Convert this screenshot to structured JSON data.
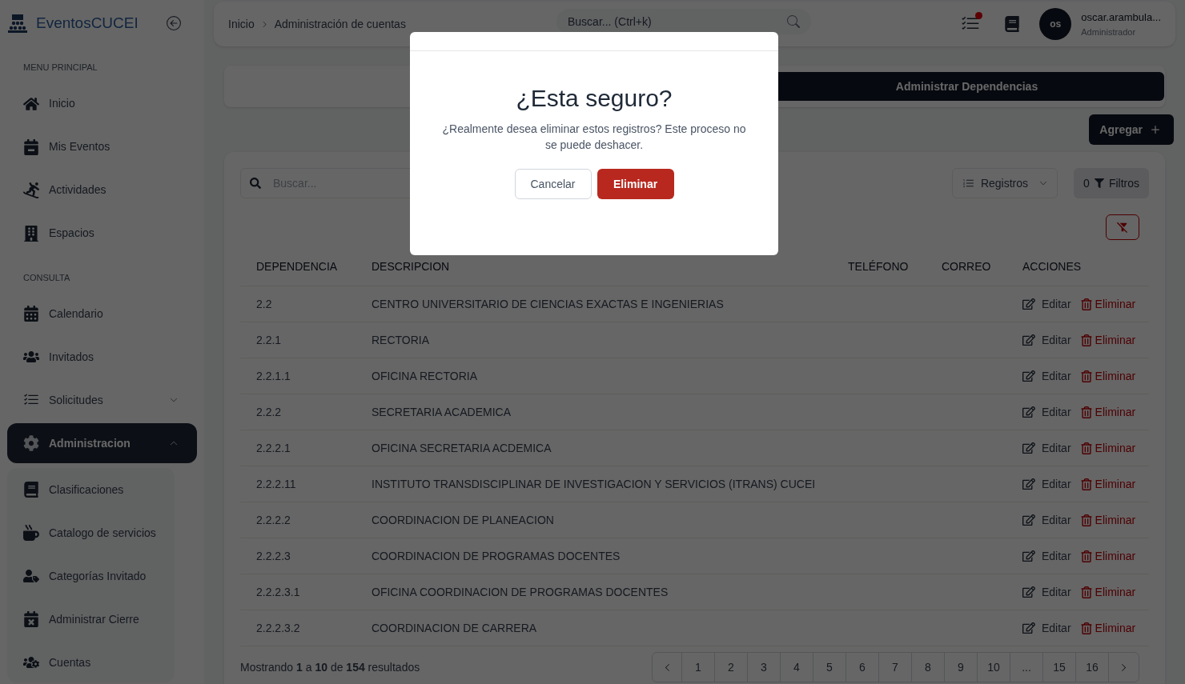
{
  "sidebar": {
    "logo_text": "EventosCUCEI",
    "sections": [
      {
        "title": "MENU PRINCIPAL",
        "items": [
          {
            "label": "Inicio",
            "selected": false
          },
          {
            "label": "Mis Eventos",
            "selected": false
          },
          {
            "label": "Actividades",
            "selected": false
          },
          {
            "label": "Espacios",
            "selected": false
          }
        ]
      },
      {
        "title": "CONSULTA",
        "items": [
          {
            "label": "Calendario",
            "selected": false
          },
          {
            "label": "Invitados",
            "selected": false
          },
          {
            "label": "Solicitudes",
            "selected": false,
            "expanded": false
          },
          {
            "label": "Administracion",
            "selected": true,
            "expanded": true,
            "children": [
              {
                "label": "Clasificaciones",
                "selected": false
              },
              {
                "label": "Catalogo de servicios",
                "selected": false
              },
              {
                "label": "Categorías Invitado",
                "selected": false
              },
              {
                "label": "Administrar Cierre",
                "selected": false
              },
              {
                "label": "Cuentas",
                "selected": false
              }
            ]
          }
        ]
      }
    ]
  },
  "header": {
    "breadcrumb": [
      "Inicio",
      "Administración de cuentas"
    ],
    "search": {
      "placeholder": "Buscar... (Ctrl+k)"
    },
    "notification": true,
    "user": {
      "initials": "os",
      "name": "oscar.arambula...",
      "role": "Administrador"
    }
  },
  "tab": {
    "label": "Administrar Dependencias",
    "selected": true
  },
  "add_button": "Agregar",
  "toolbar": {
    "search": {
      "placeholder": "Buscar..."
    },
    "records_button": "Registros",
    "filters_count": "0",
    "filters_button": "Filtros"
  },
  "table": {
    "columns": [
      "DEPENDENCIA",
      "DESCRIPCION",
      "TELÉFONO",
      "CORREO",
      "ACCIONES"
    ],
    "rows": [
      {
        "dependencia": "2.2",
        "descripcion": "CENTRO UNIVERSITARIO DE CIENCIAS EXACTAS E INGENIERIAS",
        "edit": "Editar",
        "delete": "Eliminar"
      },
      {
        "dependencia": "2.2.1",
        "descripcion": "RECTORIA",
        "edit": "Editar",
        "delete": "Eliminar"
      },
      {
        "dependencia": "2.2.1.1",
        "descripcion": "OFICINA RECTORIA",
        "edit": "Editar",
        "delete": "Eliminar"
      },
      {
        "dependencia": "2.2.2",
        "descripcion": "SECRETARIA ACADEMICA",
        "edit": "Editar",
        "delete": "Eliminar"
      },
      {
        "dependencia": "2.2.2.1",
        "descripcion": "OFICINA SECRETARIA ACDEMICA",
        "edit": "Editar",
        "delete": "Eliminar"
      },
      {
        "dependencia": "2.2.2.11",
        "descripcion": "INSTITUTO TRANSDISCIPLINAR DE INVESTIGACION Y SERVICIOS (ITRANS) CUCEI",
        "edit": "Editar",
        "delete": "Eliminar"
      },
      {
        "dependencia": "2.2.2.2",
        "descripcion": "COORDINACION DE PLANEACION",
        "edit": "Editar",
        "delete": "Eliminar"
      },
      {
        "dependencia": "2.2.2.3",
        "descripcion": "COORDINACION DE PROGRAMAS DOCENTES",
        "edit": "Editar",
        "delete": "Eliminar"
      },
      {
        "dependencia": "2.2.2.3.1",
        "descripcion": "OFICINA COORDINACION DE PROGRAMAS DOCENTES",
        "edit": "Editar",
        "delete": "Eliminar"
      },
      {
        "dependencia": "2.2.2.3.2",
        "descripcion": "COORDINACION DE CARRERA",
        "edit": "Editar",
        "delete": "Eliminar"
      }
    ]
  },
  "footer": {
    "summary": "Mostrando **1** a **10** de **154** resultados",
    "pages": [
      "1",
      "2",
      "3",
      "4",
      "5",
      "6",
      "7",
      "8",
      "9",
      "10",
      "...",
      "15",
      "16"
    ]
  },
  "modal": {
    "title": "¿Esta seguro?",
    "message": "¿Realmente desea eliminar estos registros? Este proceso no se puede deshacer.",
    "cancel": "Cancelar",
    "confirm": "Eliminar"
  }
}
